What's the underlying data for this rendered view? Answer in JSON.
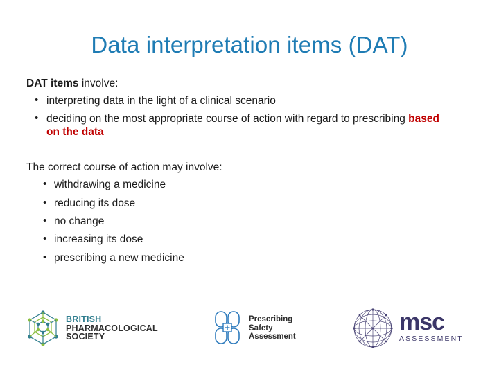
{
  "slide": {
    "title": "Data interpretation items (DAT)",
    "lead_1_bold": "DAT items",
    "lead_1_rest": " involve:",
    "bullets_1": [
      {
        "text": "interpreting data in the light of a clinical scenario",
        "emphasis": ""
      },
      {
        "text": "deciding on the most appropriate course of action with regard to prescribing ",
        "emphasis": "based on the data"
      }
    ],
    "lead_2_bold": "The correct course of action",
    "lead_2_rest": " may involve:",
    "bullets_2": [
      {
        "text": "withdrawing a medicine"
      },
      {
        "text": "reducing its dose"
      },
      {
        "text": "no change"
      },
      {
        "text": "increasing its dose"
      },
      {
        "text": "prescribing a new medicine"
      }
    ]
  },
  "logos": {
    "bps": {
      "line1": "BRITISH",
      "line2": "PHARMACOLOGICAL",
      "line3": "SOCIETY",
      "mark_name": "british-pharmacological-society-hex-icon"
    },
    "psa": {
      "line1": "Prescribing",
      "line2": "Safety",
      "line3": "Assessment",
      "mark_name": "prescribing-safety-assessment-cross-icon"
    },
    "msc": {
      "word": "msc",
      "sub": "ASSESSMENT",
      "mark_name": "msc-assessment-globe-icon"
    }
  },
  "colors": {
    "title": "#1f7cb4",
    "emphasis_red": "#c00000",
    "body_text": "#1a1a1a",
    "bps_teal": "#2f7d8e",
    "msc_purple": "#3b3668"
  }
}
